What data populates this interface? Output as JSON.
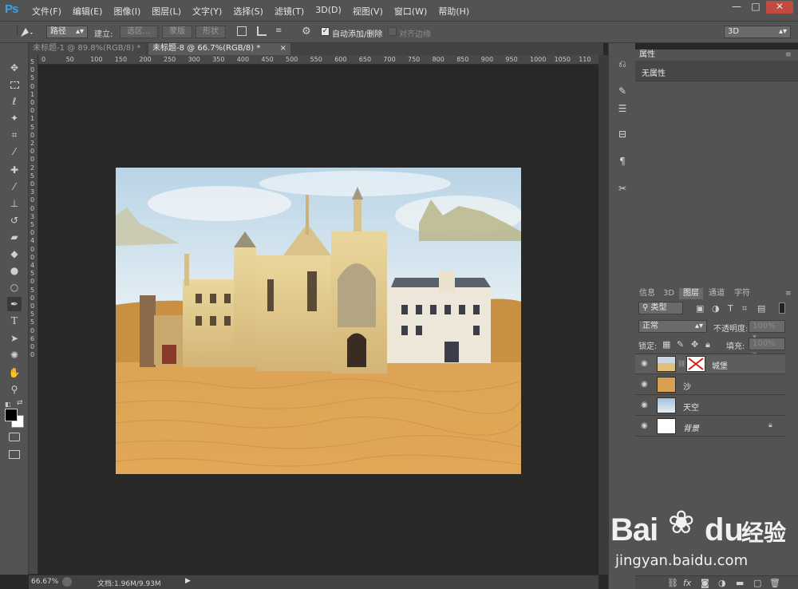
{
  "app": {
    "logo": "Ps"
  },
  "menu": [
    "文件(F)",
    "编辑(E)",
    "图像(I)",
    "图层(L)",
    "文字(Y)",
    "选择(S)",
    "滤镜(T)",
    "3D(D)",
    "视图(V)",
    "窗口(W)",
    "帮助(H)"
  ],
  "window_buttons": {
    "minimize": "—",
    "restore": "□",
    "close": "✕"
  },
  "options": {
    "mode_value": "路径",
    "build_label": "建立:",
    "selection_label": "选区...",
    "mask_label": "蒙版",
    "shape_label": "形状",
    "auto_add_label": "自动添加/删除",
    "auto_add_checked": true,
    "align_edges_label": "对齐边缘",
    "workspace_value": "3D"
  },
  "doc_tabs": [
    {
      "label": "未标题-1 @ 89.8%(RGB/8) *",
      "close": "×",
      "active": false
    },
    {
      "label": "未标题-8 @ 66.7%(RGB/8) *",
      "close": "×",
      "active": true
    }
  ],
  "ruler": {
    "h_ticks": [
      "0",
      "50",
      "100",
      "150",
      "200",
      "250",
      "300",
      "350",
      "400",
      "450",
      "500",
      "550",
      "600",
      "650",
      "700",
      "750",
      "800",
      "850",
      "900",
      "950",
      "1000",
      "1050",
      "110"
    ],
    "v_ticks": [
      "5",
      "0",
      "5",
      "0",
      "1",
      "0",
      "0",
      "1",
      "5",
      "0",
      "2",
      "0",
      "0",
      "2",
      "5",
      "0",
      "3",
      "0",
      "0",
      "3",
      "5",
      "0",
      "4",
      "0",
      "0",
      "4",
      "5",
      "0",
      "5",
      "0",
      "0",
      "5",
      "5",
      "0",
      "6",
      "0",
      "0"
    ]
  },
  "status": {
    "zoom": "66.67%",
    "doc_info": "文档:1.96M/9.93M"
  },
  "properties_panel": {
    "tab": "属性",
    "content": "无属性"
  },
  "layers_panel": {
    "tabs": [
      "信息",
      "3D",
      "图层",
      "通道",
      "字符"
    ],
    "active_tab": "图层",
    "filter_value": "类型",
    "blend_mode": "正常",
    "opacity_label": "不透明度:",
    "opacity_value": "100%",
    "lock_label": "锁定:",
    "fill_label": "填充:",
    "fill_value": "100%",
    "layers": [
      {
        "name": "城堡",
        "italic": false,
        "has_mask": true,
        "locked": false
      },
      {
        "name": "沙",
        "italic": false,
        "has_mask": false,
        "locked": false
      },
      {
        "name": "天空",
        "italic": false,
        "has_mask": false,
        "locked": false
      },
      {
        "name": "背景",
        "italic": true,
        "has_mask": false,
        "locked": true
      }
    ]
  },
  "watermark": {
    "logo": "Bai",
    "paw": "du",
    "cn": "经验",
    "url": "jingyan.baidu.com"
  },
  "colors": {
    "ui_bg": "#535353",
    "workspace": "#282828",
    "accent": "#36a3f0"
  }
}
